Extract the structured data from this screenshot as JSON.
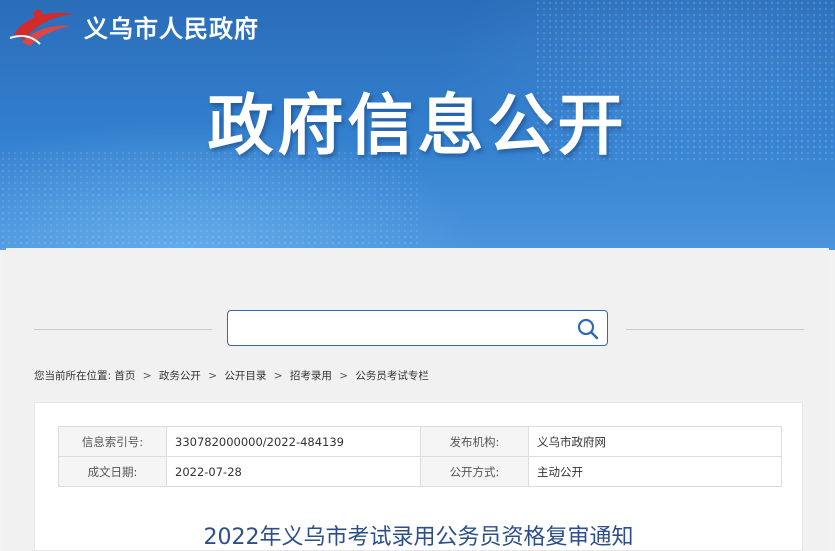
{
  "header": {
    "site_name": "义乌市人民政府",
    "page_heading": "政府信息公开",
    "logo_icon": "yiwu-city-emblem-icon"
  },
  "search": {
    "placeholder": "",
    "value": "",
    "button_icon": "search-icon"
  },
  "breadcrumb": {
    "prefix": "您当前所在位置:",
    "items": [
      "首页",
      "政务公开",
      "公开目录",
      "招考录用",
      "公务员考试专栏"
    ],
    "separator": ">"
  },
  "metadata": {
    "index_label": "信息索引号:",
    "index_value": "330782000000/2022-484139",
    "publisher_label": "发布机构:",
    "publisher_value": "义乌市政府网",
    "date_label": "成文日期:",
    "date_value": "2022-07-28",
    "disclosure_label": "公开方式:",
    "disclosure_value": "主动公开"
  },
  "document": {
    "title": "2022年义乌市考试录用公务员资格复审通知"
  },
  "colors": {
    "banner_blue": "#3380cf",
    "title_blue": "#2c4f8a",
    "search_border": "#2e6bb5",
    "logo_red": "#d32a2a"
  }
}
